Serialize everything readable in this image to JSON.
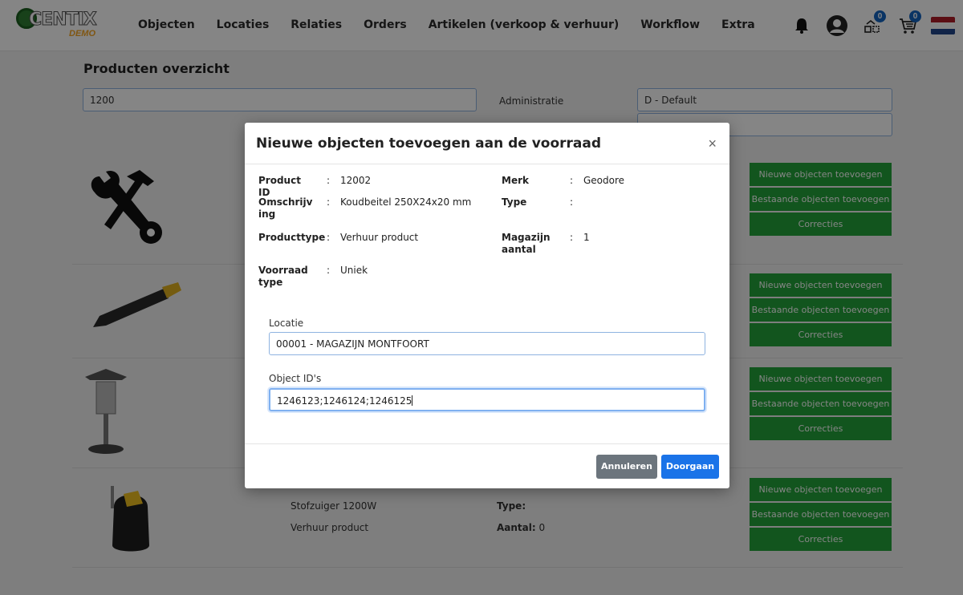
{
  "header": {
    "logo_text": "CENTIX",
    "logo_sub": "DEMO",
    "nav": [
      "Objecten",
      "Locaties",
      "Relaties",
      "Orders",
      "Artikelen (verkoop & verhuur)",
      "Workflow",
      "Extra"
    ],
    "notif_badge": "0",
    "cart_badge": "0",
    "colors": {
      "green": "#23a33a",
      "blue": "#1a73e8",
      "flag_red": "#ae1c28",
      "flag_blue": "#21468b"
    }
  },
  "page": {
    "title": "Producten overzicht",
    "search_value": "1200",
    "admin_label": "Administratie",
    "admin_value": "D - Default"
  },
  "rows": [
    {
      "buttons": [
        "Nieuwe objecten toevoegen",
        "Bestaande objecten toevoegen",
        "Correcties"
      ]
    },
    {
      "buttons": [
        "Nieuwe objecten toevoegen",
        "Bestaande objecten toevoegen",
        "Correcties"
      ]
    },
    {
      "buttons": [
        "Nieuwe objecten toevoegen",
        "Bestaande objecten toevoegen",
        "Correcties"
      ]
    },
    {
      "name": "Stofzuiger 1200W",
      "type_label": "Type:",
      "producttype": "Verhuur product",
      "aantal_label": "Aantal:",
      "aantal": "0",
      "buttons": [
        "Nieuwe objecten toevoegen",
        "Bestaande objecten toevoegen",
        "Correcties"
      ]
    }
  ],
  "modal": {
    "title": "Nieuwe objecten toevoegen aan de voorraad",
    "close": "×",
    "fields": {
      "product_id": {
        "label": "Product ID",
        "value": "12002"
      },
      "omschrijving": {
        "label": "Omschrijving",
        "value": "Koudbeitel 250X24x20 mm"
      },
      "producttype": {
        "label": "Producttype",
        "value": "Verhuur product"
      },
      "voorraad_type": {
        "label": "Voorraad type",
        "value": "Uniek"
      },
      "merk": {
        "label": "Merk",
        "value": "Geodore"
      },
      "type": {
        "label": "Type",
        "value": ""
      },
      "magazijn_aantal": {
        "label": "Magazijn aantal",
        "value": "1"
      }
    },
    "colon": ":",
    "locatie_label": "Locatie",
    "locatie_value": "00001 - MAGAZIJN MONTFOORT",
    "object_ids_label": "Object ID's",
    "object_ids_value": "1246123;1246124;1246125",
    "cancel_label": "Annuleren",
    "ok_label": "Doorgaan"
  }
}
